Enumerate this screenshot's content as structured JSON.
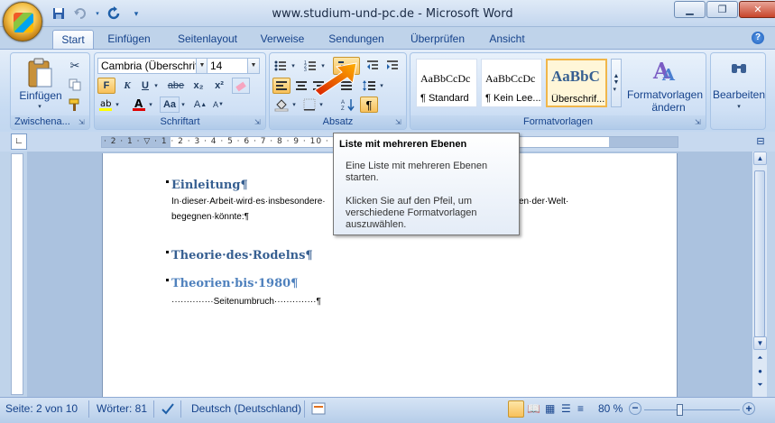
{
  "window": {
    "title": "www.studium-und-pc.de - Microsoft Word",
    "minimize_icon": "minimize-icon",
    "maximize_icon": "restore-icon",
    "close_icon": "close-icon"
  },
  "quick_access": [
    "save-icon",
    "undo-icon",
    "redo-icon",
    "customize-icon"
  ],
  "tabs": [
    {
      "label": "Start",
      "active": true
    },
    {
      "label": "Einfügen"
    },
    {
      "label": "Seitenlayout"
    },
    {
      "label": "Verweise"
    },
    {
      "label": "Sendungen"
    },
    {
      "label": "Überprüfen"
    },
    {
      "label": "Ansicht"
    }
  ],
  "ribbon": {
    "clipboard": {
      "label": "Zwischena...",
      "paste_label": "Einfügen"
    },
    "font": {
      "label": "Schriftart",
      "font_name": "Cambria (Überschrif",
      "font_size": "14",
      "bold": "F",
      "italic": "K",
      "underline": "U",
      "strike": "abe",
      "sub": "x₂",
      "sup": "x²",
      "aa": "Aa"
    },
    "paragraph": {
      "label": "Absatz",
      "pilcrow": "¶"
    },
    "styles": {
      "label": "Formatvorlagen",
      "items": [
        {
          "preview": "AaBbCcDc",
          "name": "¶ Standard"
        },
        {
          "preview": "AaBbCcDc",
          "name": "¶ Kein Lee..."
        },
        {
          "preview": "AaBbC",
          "name": "Überschrif..."
        }
      ],
      "change_label_1": "Formatvorlagen",
      "change_label_2": "ändern"
    },
    "editing": {
      "label": "Bearbeiten"
    }
  },
  "ruler": {
    "ticks": "· 2 · 1 · ▽ · 1 · 2 · 3 · 4 · 5 · 6 · 7 · 8 · 9 · 10 · 11 · 12 · 13 · 14 · 15 · △ · 17 · 18 ·"
  },
  "document": {
    "heading1": "Einleitung¶",
    "para1_line1": "In·dieser·Arbeit·wird·es·insbesondere·",
    "para1_line1_end": "en·der·Welt·",
    "para1_line2": "begegnen·könnte:¶",
    "heading2": "Theorie·des·Rodelns¶",
    "heading3": "Theorien·bis·1980¶",
    "pagebreak": "··············Seitenumbruch··············¶"
  },
  "tooltip": {
    "title": "Liste mit mehreren Ebenen",
    "line1": "Eine Liste mit mehreren Ebenen starten.",
    "line2": "Klicken Sie auf den Pfeil, um verschiedene Formatvorlagen auszuwählen."
  },
  "status": {
    "page": "Seite: 2 von 10",
    "words": "Wörter: 81",
    "language": "Deutsch (Deutschland)",
    "zoom": "80 %"
  },
  "colors": {
    "heading": "#365f91",
    "subheading": "#4f81bd",
    "ribbon_text": "#15428b"
  }
}
